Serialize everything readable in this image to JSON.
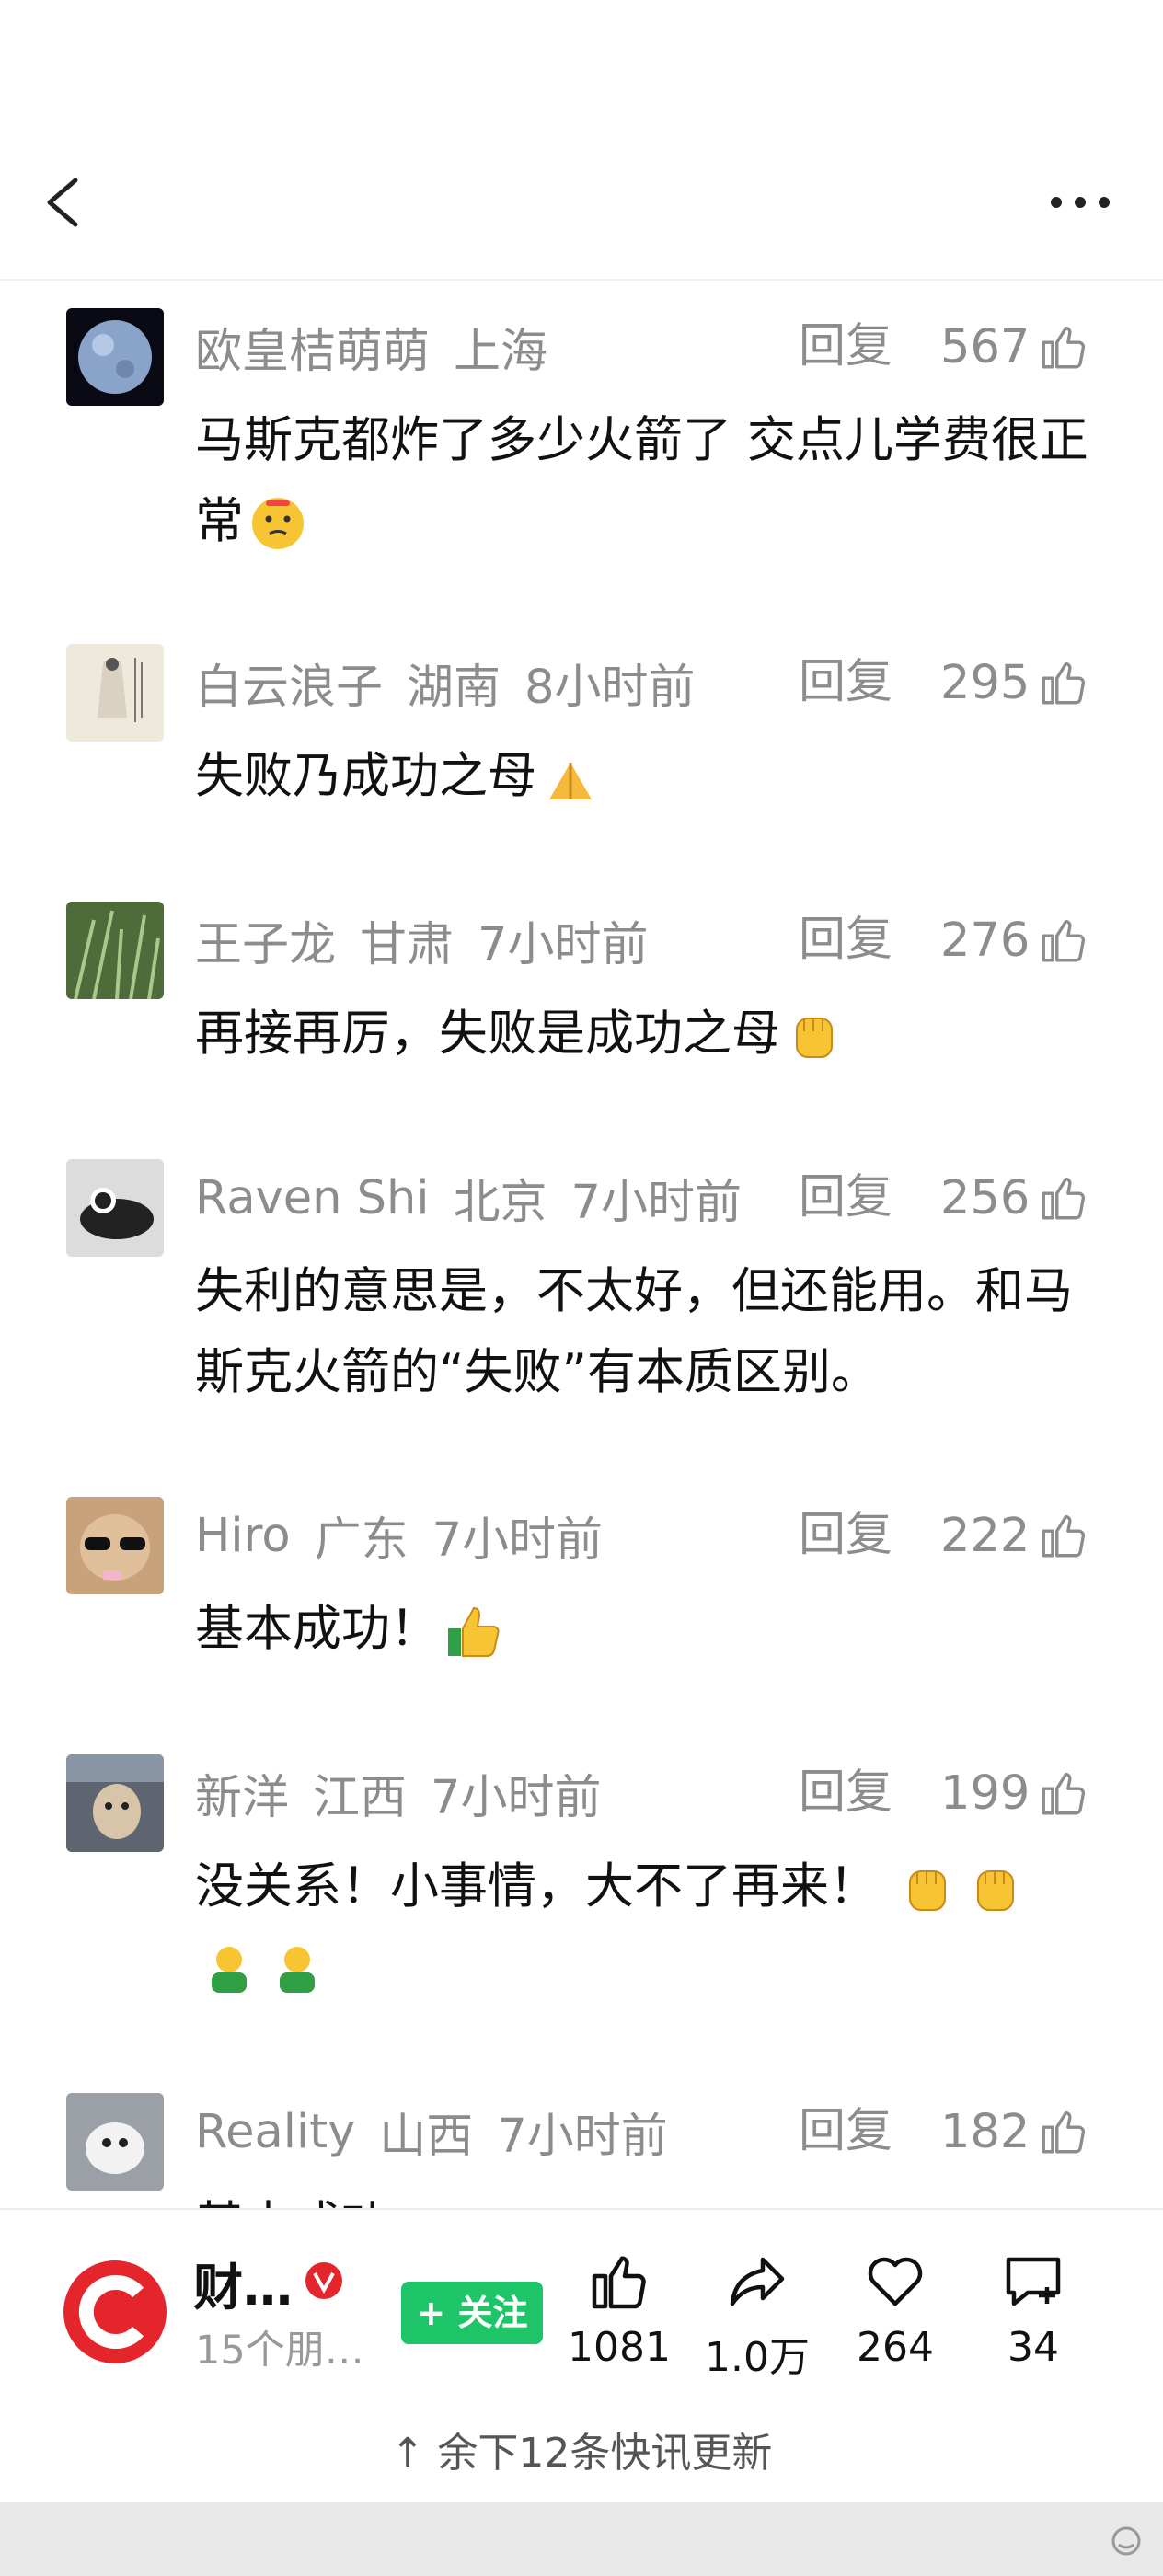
{
  "nav": {
    "back_icon": "chevron-left-icon",
    "more_icon": "ellipsis-icon"
  },
  "comments": [
    {
      "user": "欧皇桔萌萌",
      "location": "上海",
      "time": "",
      "reply": "回复",
      "likes": "567",
      "text": "马斯克都炸了多少火箭了 交点儿学费很正常",
      "emoji": [
        "thinking-face-icon"
      ]
    },
    {
      "user": "白云浪子",
      "location": "湖南",
      "time": "8小时前",
      "reply": "回复",
      "likes": "295",
      "text": "失败乃成功之母",
      "emoji": [
        "pray-hands-icon"
      ]
    },
    {
      "user": "王子龙",
      "location": "甘肃",
      "time": "7小时前",
      "reply": "回复",
      "likes": "276",
      "text": "再接再厉，失败是成功之母",
      "emoji": [
        "raised-fist-icon"
      ]
    },
    {
      "user": "Raven Shi",
      "location": "北京",
      "time": "7小时前",
      "reply": "回复",
      "likes": "256",
      "text": "失利的意思是，不太好，但还能用。和马斯克火箭的“失败”有本质区别。",
      "emoji": []
    },
    {
      "user": "Hiro",
      "location": "广东",
      "time": "7小时前",
      "reply": "回复",
      "likes": "222",
      "text": "基本成功！",
      "emoji": [
        "thumbs-up-icon"
      ]
    },
    {
      "user": "新洋",
      "location": "江西",
      "time": "7小时前",
      "reply": "回复",
      "likes": "199",
      "text": "没关系！小事情，大不了再来！",
      "emoji": [
        "raised-fist-icon",
        "raised-fist-icon",
        "green-figure-icon",
        "green-figure-icon"
      ]
    },
    {
      "user": "Reality",
      "location": "山西",
      "time": "7小时前",
      "reply": "回复",
      "likes": "182",
      "text": "基本成功",
      "emoji": []
    }
  ],
  "account": {
    "name": "财…",
    "subtitle": "15个朋…",
    "follow_label": "+ 关注",
    "verified_icon": "verified-v-icon"
  },
  "actions": [
    {
      "name": "like",
      "icon": "thumbs-up-icon",
      "count": "1081"
    },
    {
      "name": "share",
      "icon": "share-arrow-icon",
      "count": "1.0万"
    },
    {
      "name": "favorite",
      "icon": "heart-icon",
      "count": "264"
    },
    {
      "name": "comment",
      "icon": "comment-plus-icon",
      "count": "34"
    }
  ],
  "update_bar": "↑ 余下12条快讯更新",
  "colors": {
    "follow_green": "#1ec468",
    "logo_red": "#e4262c",
    "meta_gray": "#8c8c8c"
  }
}
